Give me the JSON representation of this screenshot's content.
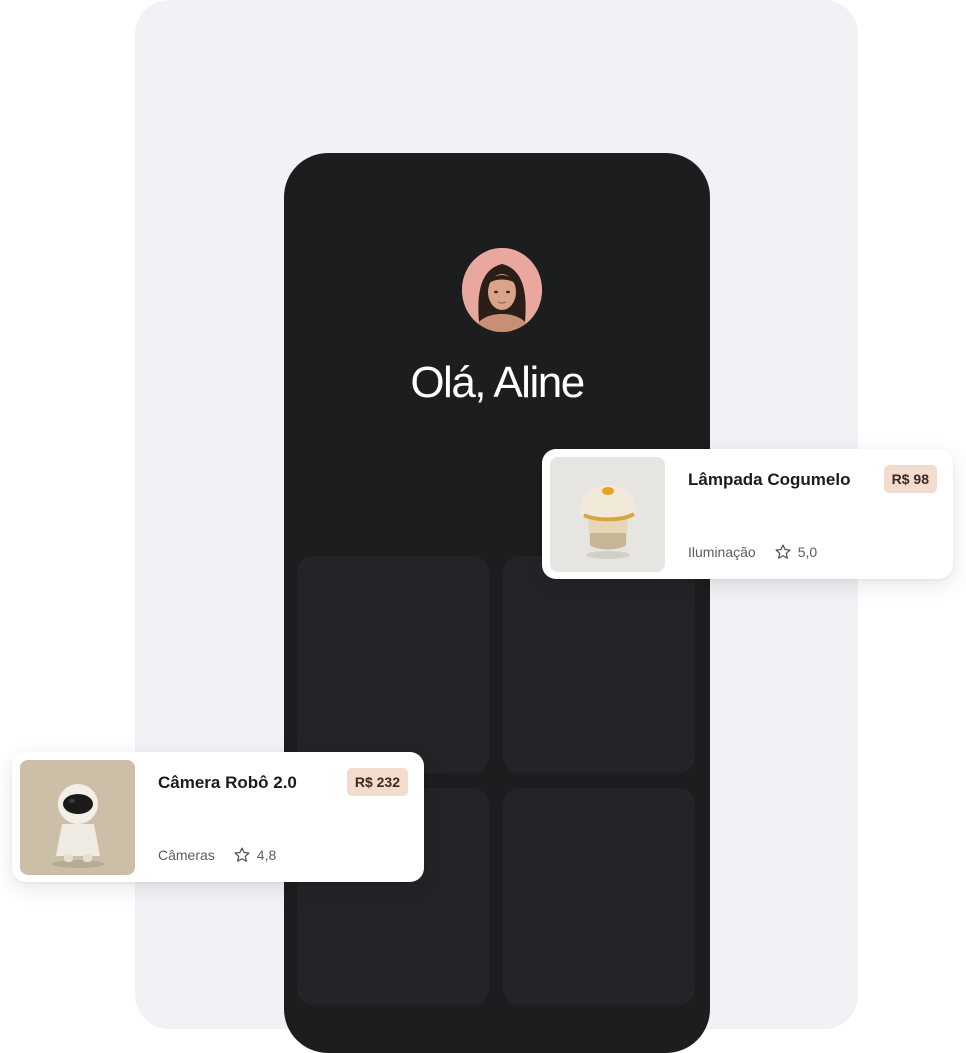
{
  "greeting": "Olá, Aline",
  "products": [
    {
      "title": "Lâmpada Cogumelo",
      "price": "R$ 98",
      "category": "Iluminação",
      "rating": "5,0",
      "icon": "star-outline-icon"
    },
    {
      "title": "Câmera Robô 2.0",
      "price": "R$ 232",
      "category": "Câmeras",
      "rating": "4,8",
      "icon": "star-outline-icon"
    }
  ],
  "colors": {
    "phone_bg": "#1c1d1f",
    "tile_bg": "#232427",
    "page_panel": "#f1f2f5",
    "price_badge": "#f3dccd",
    "avatar_bg": "#e9a89d"
  }
}
